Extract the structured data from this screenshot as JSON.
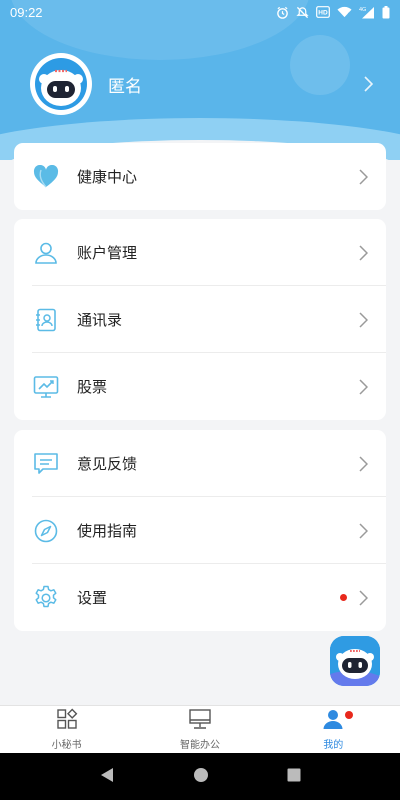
{
  "status_bar": {
    "time": "09:22",
    "icons": [
      "alarm-icon",
      "mute-icon",
      "hd-icon",
      "wifi-icon",
      "signal-4g-icon"
    ]
  },
  "profile": {
    "name": "匿名"
  },
  "colors": {
    "header": "#5ab5ea",
    "accent": "#2e8ae0",
    "icon": "#5bbbe6",
    "badge": "#e8281c"
  },
  "menu": {
    "health": {
      "label": "健康中心",
      "icon": "heart-icon"
    },
    "account": {
      "label": "账户管理",
      "icon": "user-icon"
    },
    "contacts": {
      "label": "通讯录",
      "icon": "address-book-icon"
    },
    "stocks": {
      "label": "股票",
      "icon": "stock-chart-icon"
    },
    "feedback": {
      "label": "意见反馈",
      "icon": "feedback-icon"
    },
    "guide": {
      "label": "使用指南",
      "icon": "compass-icon"
    },
    "settings": {
      "label": "设置",
      "icon": "gear-icon"
    }
  },
  "tabs": [
    {
      "label": "小秘书",
      "icon": "apps-icon"
    },
    {
      "label": "智能办公",
      "icon": "desktop-icon"
    },
    {
      "label": "我的",
      "icon": "person-icon"
    }
  ]
}
